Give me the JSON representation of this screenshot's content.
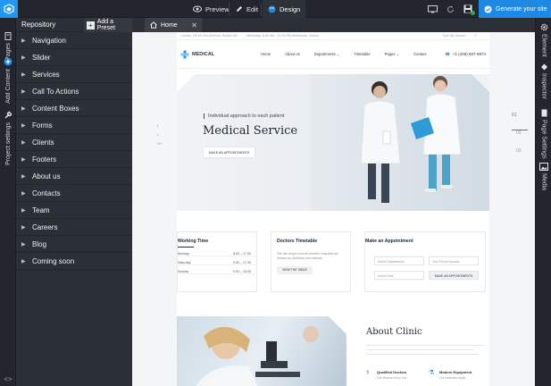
{
  "topbar": {
    "preview_label": "Preview",
    "edit_label": "Edit",
    "design_label": "Design",
    "generate_label": "Generate your site"
  },
  "left_strip": {
    "tabs": [
      "Pages",
      "Add Content",
      "Project settings"
    ]
  },
  "right_strip": {
    "tabs": [
      "Element",
      "Inspector",
      "Page Settings",
      "Media"
    ]
  },
  "repository": {
    "title": "Repository",
    "preset_label": "Add a Preset",
    "items": [
      {
        "label": "Navigation"
      },
      {
        "label": "Slider"
      },
      {
        "label": "Services"
      },
      {
        "label": "Call To Actions"
      },
      {
        "label": "Content Boxes"
      },
      {
        "label": "Forms"
      },
      {
        "label": "Clients"
      },
      {
        "label": "Footers"
      },
      {
        "label": "About us"
      },
      {
        "label": "Contacts"
      },
      {
        "label": "Team"
      },
      {
        "label": "Careers"
      },
      {
        "label": "Blog"
      },
      {
        "label": "Coming soon"
      }
    ]
  },
  "tab": {
    "label": "Home"
  },
  "site": {
    "topinfo": [
      "London, UK 65 Zinc Avenue, Ruskin Intl",
      "Weekdays: 8.00 AM - 20.00 PM  Weekends: Closed"
    ],
    "search_placeholder": "Start My Search",
    "brand": "MEDICAL",
    "menu": [
      "Home",
      "About us",
      "Departments ⌄",
      "Timetable",
      "Pages ⌄",
      "Contact"
    ],
    "phone": "+1 (409) 987-5874",
    "hero": {
      "subtitle": "Individual approach to each patient",
      "title": "Medical Service",
      "button": "MAKE AN APPOINTMENTS"
    },
    "social": [
      "f",
      "t",
      "G+"
    ],
    "slides": [
      "01",
      "02",
      "03"
    ],
    "working_time": {
      "title": "Working Time",
      "rows": [
        {
          "day": "Monday",
          "time": "8.00 – 17.00"
        },
        {
          "day": "Saturday",
          "time": "9.00 – 17.30"
        },
        {
          "day": "Sunday",
          "time": "9.00 – 15.00"
        }
      ]
    },
    "doctors": {
      "title": "Doctors Timetable",
      "text": "Dial the unique summit between Hospitals are doctors as. Medicine and medical.",
      "button": "VIEW THE TABLE"
    },
    "appointment": {
      "title": "Make an Appointment",
      "fields": [
        "Select Departments",
        "Your Phone Number",
        "Select Date"
      ],
      "button": "MAKE AN APPOINTMENTS"
    },
    "about": {
      "title": "About Clinic",
      "features": [
        {
          "title": "Qualified Doctors",
          "text": "Our doctors every one"
        },
        {
          "title": "Modern Equipment",
          "text": "Our medicine equip."
        }
      ]
    }
  }
}
